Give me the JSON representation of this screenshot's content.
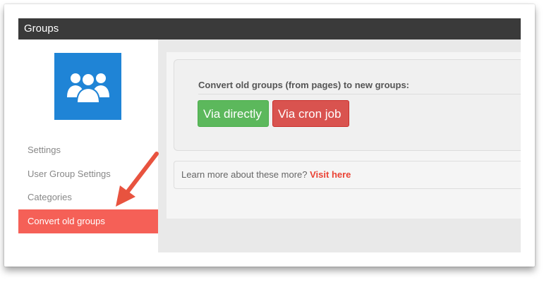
{
  "window": {
    "title": "Groups"
  },
  "sidebar": {
    "app_icon": "users-group-icon",
    "items": [
      {
        "label": "Settings",
        "active": false
      },
      {
        "label": "User Group Settings",
        "active": false
      },
      {
        "label": "Categories",
        "active": false
      },
      {
        "label": "Convert old groups",
        "active": true
      }
    ]
  },
  "main": {
    "panel_title": "Convert old groups (from pages) to new groups:",
    "buttons": {
      "directly": "Via directly",
      "cron": "Via cron job"
    },
    "info_text": "Learn more about these more?",
    "info_link": "Visit here"
  },
  "annotation": {
    "icon": "red-arrow-icon"
  },
  "colors": {
    "titlebar": "#3a3a3a",
    "accent_active": "#f56057",
    "icon_bg": "#1f84d6",
    "btn_green": "#5cb85c",
    "btn_red": "#d9534f",
    "link": "#ea4335"
  }
}
